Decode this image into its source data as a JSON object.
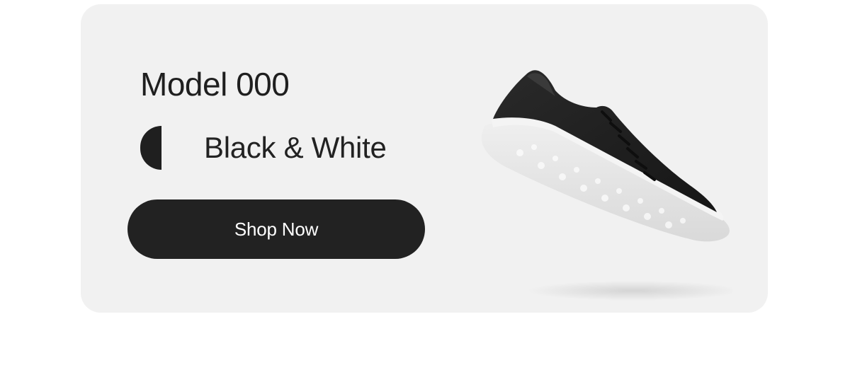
{
  "product": {
    "title": "Model 000",
    "colorway": {
      "label": "Black & White",
      "swatch_color": "#1f1f1f"
    },
    "cta_label": "Shop Now",
    "image_icon": "sneaker-image",
    "colors": {
      "card_bg": "#f1f1f1",
      "button_bg": "#222222",
      "button_text": "#ffffff",
      "shoe_upper": "#1e1e1e",
      "shoe_sole": "#e6e6e6"
    }
  }
}
